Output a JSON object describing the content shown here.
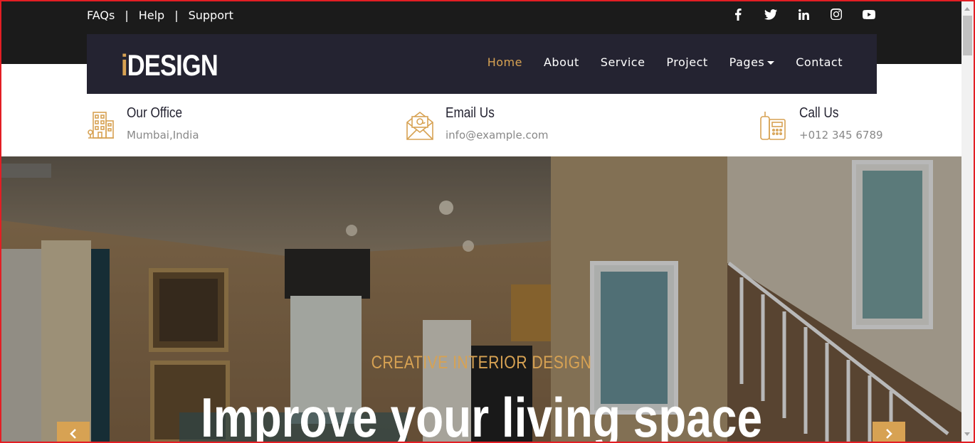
{
  "topbar": {
    "links": [
      "FAQs",
      "Help",
      "Support"
    ],
    "separator": "|",
    "social": [
      "facebook-icon",
      "twitter-icon",
      "linkedin-icon",
      "instagram-icon",
      "youtube-icon"
    ]
  },
  "brand": {
    "prefix": "i",
    "name": "DESIGN"
  },
  "nav": {
    "items": [
      "Home",
      "About",
      "Service",
      "Project",
      "Pages",
      "Contact"
    ],
    "active": "Home"
  },
  "info": [
    {
      "icon": "building-icon",
      "title": "Our Office",
      "value": "Mumbai,India"
    },
    {
      "icon": "envelope-icon",
      "title": "Email Us",
      "value": "info@example.com"
    },
    {
      "icon": "phone-icon",
      "title": "Call Us",
      "value": "+012 345 6789"
    }
  ],
  "hero": {
    "kicker": "CREATIVE INTERIOR DESIGN",
    "title": "Improve your living space"
  },
  "colors": {
    "accent": "#d7a253",
    "dark": "#242331",
    "topbar": "#1b1b1b"
  }
}
